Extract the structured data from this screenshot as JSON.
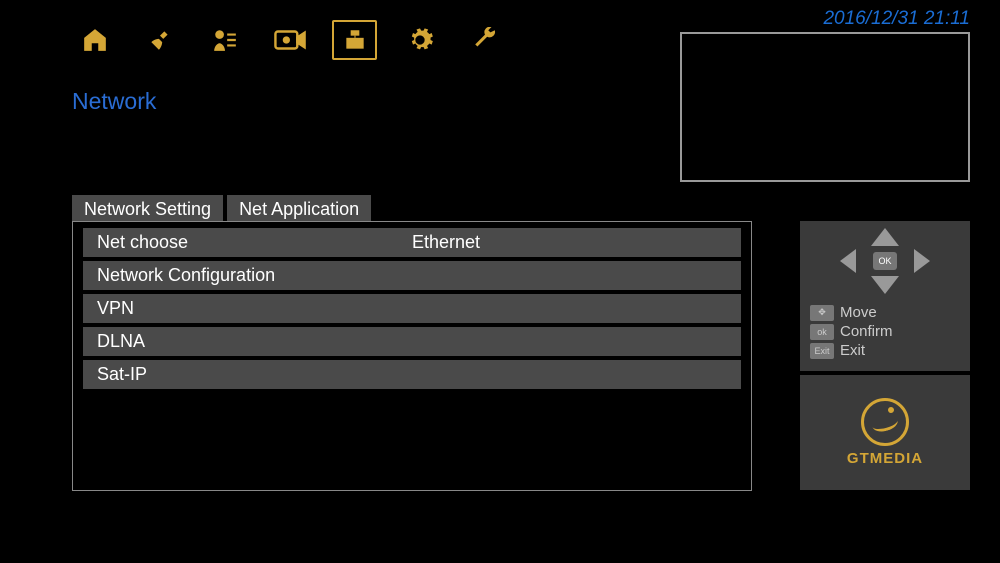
{
  "header": {
    "datetime": "2016/12/31  21:11",
    "icons": [
      {
        "name": "home-icon"
      },
      {
        "name": "satellite-icon"
      },
      {
        "name": "user-list-icon"
      },
      {
        "name": "camera-icon"
      },
      {
        "name": "network-icon",
        "selected": true
      },
      {
        "name": "settings-gear-icon"
      },
      {
        "name": "tools-wrench-icon"
      }
    ]
  },
  "section": {
    "title": "Network"
  },
  "tabs": [
    {
      "label": "Network Setting",
      "active": true
    },
    {
      "label": "Net Application",
      "active": false
    }
  ],
  "options": [
    {
      "label": "Net choose",
      "value": "Ethernet"
    },
    {
      "label": "Network Configuration",
      "value": ""
    },
    {
      "label": "VPN",
      "value": ""
    },
    {
      "label": "DLNA",
      "value": ""
    },
    {
      "label": "Sat-IP",
      "value": ""
    }
  ],
  "hints": {
    "ok_label": "OK",
    "move": "Move",
    "confirm": "Confirm",
    "exit": "Exit",
    "move_key": "✥",
    "confirm_key": "ok",
    "exit_key": "Exit"
  },
  "brand": {
    "name": "GTMEDIA"
  }
}
